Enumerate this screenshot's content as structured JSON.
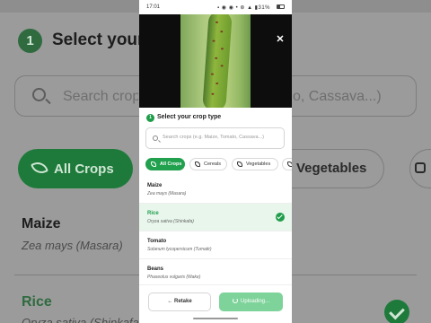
{
  "status_bar": {
    "time": "17:01",
    "icons": "▪ ◉ ◉ • ⊛ ▲ ▮31%"
  },
  "background_page": {
    "step_number": "1",
    "title": "Select your crop type",
    "search_left": "Search crops (e.g. Maize, Tomato, Cassava...)",
    "search_right": "o, Cassava...)",
    "chip_all": "All Crops",
    "chip_right": "Vegetables",
    "crop1_name": "Maize",
    "crop1_sci": "Zea mays (Masara)",
    "crop2_name": "Rice",
    "crop2_sci": "Oryza sativa (Shinkafa)"
  },
  "sheet": {
    "step_number": "1",
    "title": "Select your crop type",
    "search_placeholder": "Search crops (e.g. Maize, Tomato, Cassava...)",
    "filter_chips": [
      {
        "label": "All Crops",
        "icon": "leaf-icon",
        "active": true
      },
      {
        "label": "Cereals",
        "icon": "grain-icon",
        "active": false
      },
      {
        "label": "Vegetables",
        "icon": "carrot-icon",
        "active": false
      }
    ],
    "crops": [
      {
        "name": "Maize",
        "scientific": "Zea mays (Masara)",
        "selected": false
      },
      {
        "name": "Rice",
        "scientific": "Oryza sativa (Shinkafa)",
        "selected": true
      },
      {
        "name": "Tomato",
        "scientific": "Solanum lycopersicum (Tumatir)",
        "selected": false
      },
      {
        "name": "Beans",
        "scientific": "Phaseolus vulgaris (Wake)",
        "selected": false
      }
    ],
    "retake_label": "Retake",
    "upload_label": "Uploading...",
    "retake_icon": "back-arrow-icon",
    "close_icon": "close-icon"
  },
  "colors": {
    "accent": "#1f9d4a",
    "accent_light": "#7ed39a",
    "selected_row": "#e8f6ec"
  }
}
